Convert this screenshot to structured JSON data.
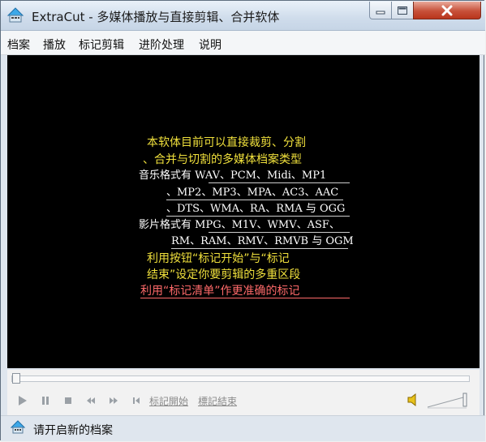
{
  "window": {
    "title": "ExtraCut - 多媒体播放与直接剪辑、合并软体"
  },
  "menu": {
    "items": [
      {
        "label": "档案"
      },
      {
        "label": "播放"
      },
      {
        "label": "标记剪辑"
      },
      {
        "label": "进阶处理"
      },
      {
        "label": "说明"
      }
    ]
  },
  "video": {
    "lines": [
      "本软体目前可以直接裁剪、分割",
      "、合并与切割的多媒体档案类型",
      "音乐格式有 WAV、PCM、Midi、MP1",
      "、MP2、MP3、MPA、AC3、AAC",
      "、DTS、WMA、RA、RMA 与 OGG",
      "影片格式有 MPG、M1V、WMV、ASF、",
      "RM、RAM、RMV、RMVB 与 OGM",
      "利用按钮“标记开始”与“标记",
      "结束”设定你要剪辑的多重区段",
      "利用“标记清单”作更准确的标记"
    ],
    "colors": {
      "yellow": "#f0e03c",
      "white": "#ffffff",
      "pink": "#ff6a6a",
      "background": "#000000"
    }
  },
  "controls": {
    "play_icon": "play-icon",
    "pause_icon": "pause-icon",
    "stop_icon": "stop-icon",
    "rewind_icon": "rewind-icon",
    "forward_icon": "fast-forward-icon",
    "mark_icon": "mark-start-icon",
    "mark_start": "标記開始",
    "mark_end": "標記結束",
    "volume_icon": "speaker-icon"
  },
  "status": {
    "text": "请开启新的档案",
    "icon": "app-icon"
  }
}
